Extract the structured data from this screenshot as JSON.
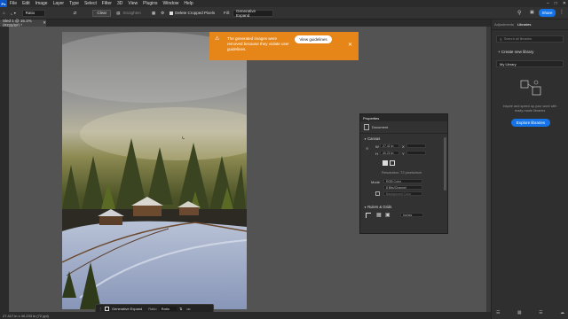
{
  "app": {
    "logo": "Ps"
  },
  "menu": [
    "File",
    "Edit",
    "Image",
    "Layer",
    "Type",
    "Select",
    "Filter",
    "3D",
    "View",
    "Plugins",
    "Window",
    "Help"
  ],
  "options": {
    "ratio": "Ratio",
    "clear": "Clear",
    "straighten": "Straighten",
    "delete_cropped": "Delete Cropped Pixels",
    "fill_label": "Fill:",
    "fill_value": "Generative Expand"
  },
  "share": "Share",
  "document": {
    "tab_title": "Sled 1 @ 16.1% (RGB/8#) *"
  },
  "notification": {
    "message": "The generated images were removed because they violate user guidelines.",
    "button": "View guidelines"
  },
  "properties": {
    "title": "Properties",
    "doc_label": "Document",
    "canvas_label": "Canvas",
    "w_label": "W",
    "w_value": "27.42 in",
    "h_label": "H",
    "h_value": "40.23 in",
    "x_label": "X",
    "y_label": "Y",
    "resolution": "Resolution: 72 pixels/inch",
    "mode_label": "Mode",
    "mode_value": "RGB Color",
    "depth_value": "8 Bits/Channel",
    "fill_placeholder": "Background Color",
    "rulers_label": "Rulers & Grids",
    "units_value": "Inches"
  },
  "right_panel": {
    "tab_adjustments": "Adjustments",
    "tab_libraries": "Libraries",
    "search_placeholder": "Search all libraries",
    "create_label": "+ Create new library",
    "library_select": "My Library",
    "empty_text": "Inspire and speed up your work with ready-made libraries",
    "explore_button": "Explore libraries"
  },
  "statusbar": {
    "text": "27.417 in x 40.233 in (72 ppi)"
  },
  "context_bar": {
    "generative": "Generative Expand",
    "ratio_label": "Ratio",
    "ratio_value": "Ratio",
    "more": "•••"
  },
  "colors": {
    "accent": "#1473e6",
    "warning": "#e68619",
    "panel": "#323232"
  }
}
